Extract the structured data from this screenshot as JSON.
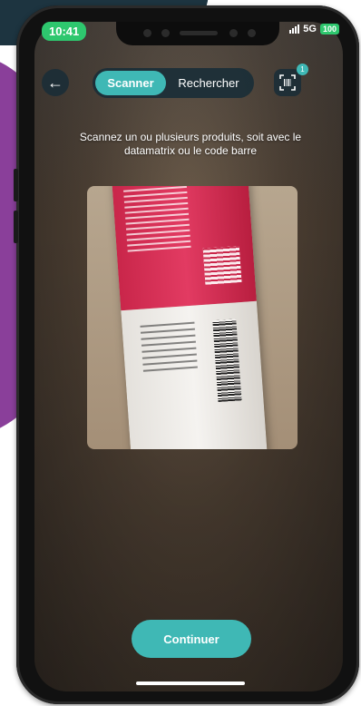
{
  "status_bar": {
    "time": "10:41",
    "network": "5G",
    "battery": "100"
  },
  "header": {
    "back_icon": "arrow-left-icon",
    "tabs": [
      {
        "label": "Scanner",
        "active": true
      },
      {
        "label": "Rechercher",
        "active": false
      }
    ],
    "scanned_count": "1",
    "scan_list_icon": "barcode-scan-icon"
  },
  "instruction": "Scannez un ou plusieurs produits, soit avec le datamatrix ou le code barre",
  "footer": {
    "continue_label": "Continuer"
  },
  "colors": {
    "accent": "#3fb8b5",
    "status_green": "#2ec76e",
    "control_bg": "#192d37"
  }
}
